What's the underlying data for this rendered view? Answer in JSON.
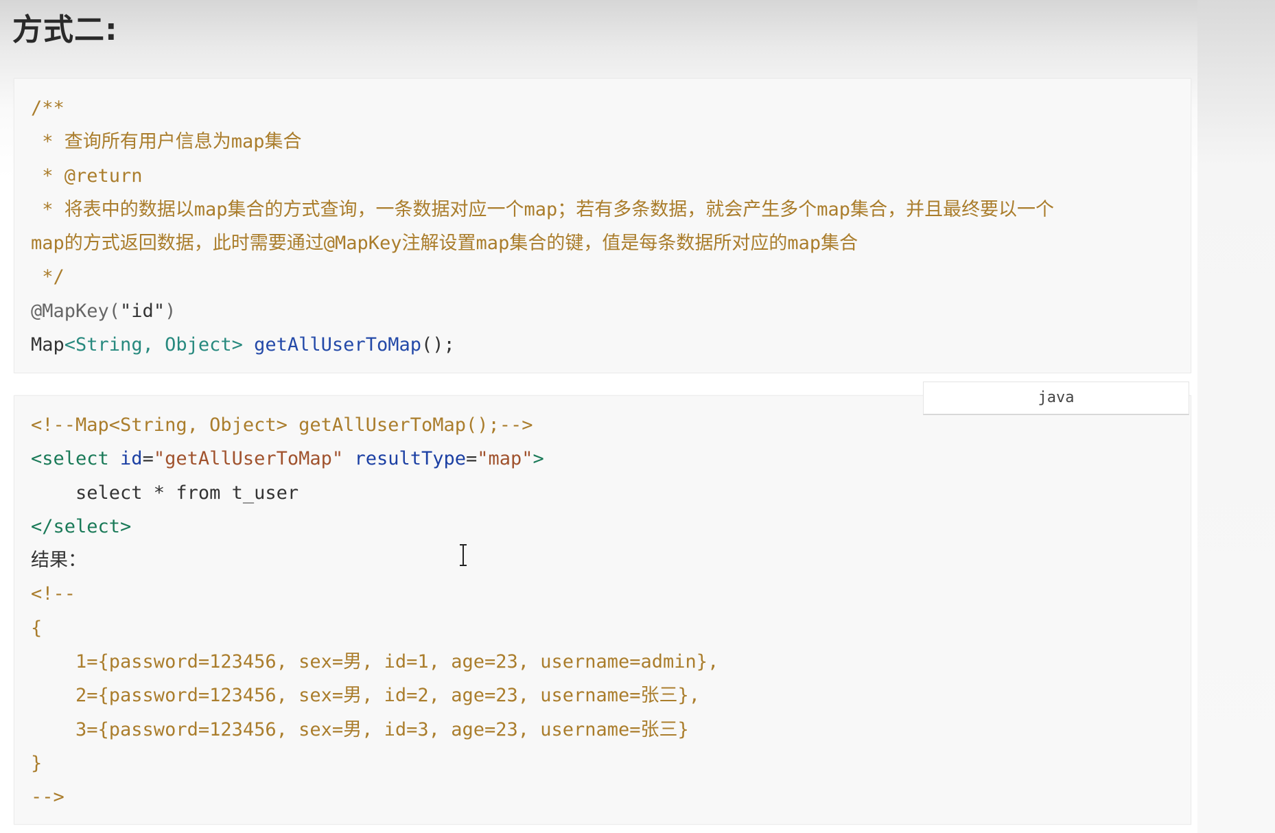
{
  "heading": "方式二:",
  "java_block": {
    "lines": [
      [
        {
          "t": "/**",
          "c": "c-comment"
        }
      ],
      [
        {
          "t": " * 查询所有用户信息为map集合",
          "c": "c-comment"
        }
      ],
      [
        {
          "t": " * @return",
          "c": "c-comment"
        }
      ],
      [
        {
          "t": " * 将表中的数据以map集合的方式查询，一条数据对应一个map；若有多条数据，就会产生多个map集合，并且最终要以一个",
          "c": "c-comment"
        }
      ],
      [
        {
          "t": "map的方式返回数据，此时需要通过@MapKey注解设置map集合的键，值是每条数据所对应的map集合",
          "c": "c-comment"
        }
      ],
      [
        {
          "t": " */",
          "c": "c-comment"
        }
      ],
      [
        {
          "t": "@MapKey(",
          "c": "c-ann"
        },
        {
          "t": "\"id\"",
          "c": "c-plain"
        },
        {
          "t": ")",
          "c": "c-ann"
        }
      ],
      [
        {
          "t": "Map",
          "c": "c-plain"
        },
        {
          "t": "<String, Object>",
          "c": "c-type"
        },
        {
          "t": " ",
          "c": "c-plain"
        },
        {
          "t": "getAllUserToMap",
          "c": "c-fn"
        },
        {
          "t": "();",
          "c": "c-plain"
        }
      ]
    ]
  },
  "lang_label": "java",
  "xml_block": {
    "lines": [
      [
        {
          "t": "<!--Map<String, Object> getAllUserToMap();-->",
          "c": "c-comment"
        }
      ],
      [
        {
          "t": "<select ",
          "c": "c-tag"
        },
        {
          "t": "id",
          "c": "c-attr"
        },
        {
          "t": "=",
          "c": "c-plain"
        },
        {
          "t": "\"getAllUserToMap\"",
          "c": "c-str"
        },
        {
          "t": " ",
          "c": "c-plain"
        },
        {
          "t": "resultType",
          "c": "c-attr"
        },
        {
          "t": "=",
          "c": "c-plain"
        },
        {
          "t": "\"map\"",
          "c": "c-str"
        },
        {
          "t": ">",
          "c": "c-tag"
        }
      ],
      [
        {
          "t": "    select * from t_user",
          "c": "c-plain"
        }
      ],
      [
        {
          "t": "</select>",
          "c": "c-tag"
        }
      ],
      [
        {
          "t": "结果：",
          "c": "c-plain"
        }
      ],
      [
        {
          "t": "<!--",
          "c": "c-comment"
        }
      ],
      [
        {
          "t": "{",
          "c": "c-comment"
        }
      ],
      [
        {
          "t": "    1={password=123456, sex=男, id=1, age=23, username=admin},",
          "c": "c-comment"
        }
      ],
      [
        {
          "t": "    2={password=123456, sex=男, id=2, age=23, username=张三},",
          "c": "c-comment"
        }
      ],
      [
        {
          "t": "    3={password=123456, sex=男, id=3, age=23, username=张三}",
          "c": "c-comment"
        }
      ],
      [
        {
          "t": "}",
          "c": "c-comment"
        }
      ],
      [
        {
          "t": "-->",
          "c": "c-comment"
        }
      ]
    ]
  }
}
